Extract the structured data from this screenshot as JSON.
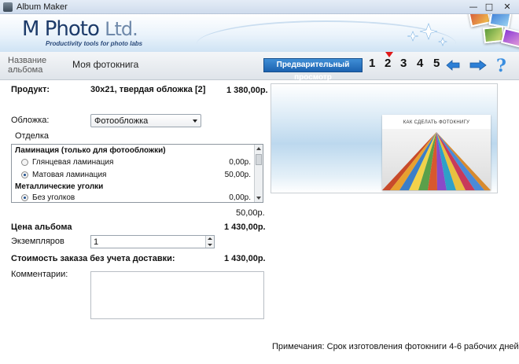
{
  "window": {
    "title": "Album Maker",
    "minimize_glyph": "—",
    "maximize_glyph": "□",
    "close_glyph": "✕"
  },
  "banner": {
    "logo_main": "M Photo",
    "logo_suffix": "Ltd.",
    "tagline": "Productivity tools for photo labs"
  },
  "nav": {
    "album_name_label": "Название альбома",
    "album_name_value": "Моя фотокнига",
    "preview_button": "Предварительный просмотр",
    "steps": [
      "1",
      "2",
      "3",
      "4",
      "5"
    ],
    "current_step": "2",
    "back_icon": "arrow-left-icon",
    "forward_icon": "arrow-right-icon",
    "help_glyph": "?"
  },
  "product": {
    "label": "Продукт:",
    "name": "30x21, твердая обложка [2]",
    "price": "1 380,00р."
  },
  "cover": {
    "label": "Обложка:",
    "selected": "Фотообложка"
  },
  "finishing": {
    "label": "Отделка",
    "groups": [
      {
        "title": "Ламинация (только для фотообложки)",
        "options": [
          {
            "label": "Глянцевая ламинация",
            "price": "0,00р.",
            "checked": false
          },
          {
            "label": "Матовая ламинация",
            "price": "50,00р.",
            "checked": true
          }
        ]
      },
      {
        "title": "Металлические уголки",
        "options": [
          {
            "label": "Без уголков",
            "price": "0,00р.",
            "checked": true
          }
        ]
      }
    ],
    "subtotal": "50,00р."
  },
  "album_price": {
    "label": "Цена альбома",
    "value": "1 430,00р."
  },
  "copies": {
    "label": "Экземпляров",
    "value": "1"
  },
  "order_total": {
    "label": "Стоимость заказа без учета доставки:",
    "value": "1 430,00р."
  },
  "comments": {
    "label": "Комментарии:",
    "value": ""
  },
  "preview": {
    "book_caption": "КАК СДЕЛАТЬ ФОТОКНИГУ"
  },
  "footer_note": "Примечания: Срок изготовления фотокниги 4-6 рабочих дней",
  "colors": {
    "accent": "#1d63b0",
    "step_marker": "#e01919",
    "arrow_icon": "#2d7fd6"
  }
}
